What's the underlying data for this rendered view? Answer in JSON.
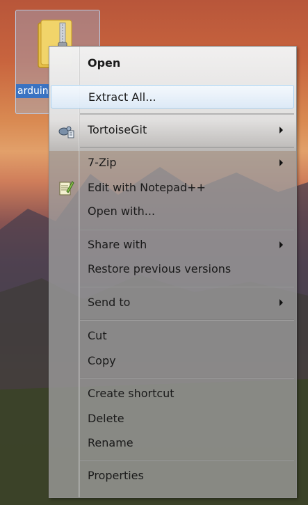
{
  "desktop_icon": {
    "label": "arduino-windows"
  },
  "menu": {
    "items": [
      {
        "label": "Open"
      },
      {
        "label": "Extract All..."
      },
      {
        "label": "TortoiseGit"
      },
      {
        "label": "7-Zip"
      },
      {
        "label": "Edit with Notepad++"
      },
      {
        "label": "Open with..."
      },
      {
        "label": "Share with"
      },
      {
        "label": "Restore previous versions"
      },
      {
        "label": "Send to"
      },
      {
        "label": "Cut"
      },
      {
        "label": "Copy"
      },
      {
        "label": "Create shortcut"
      },
      {
        "label": "Delete"
      },
      {
        "label": "Rename"
      },
      {
        "label": "Properties"
      }
    ]
  },
  "icons": {
    "tortoisegit": "tortoisegit-icon",
    "notepadpp": "notepadpp-icon",
    "submenu": "chevron-right-icon"
  }
}
